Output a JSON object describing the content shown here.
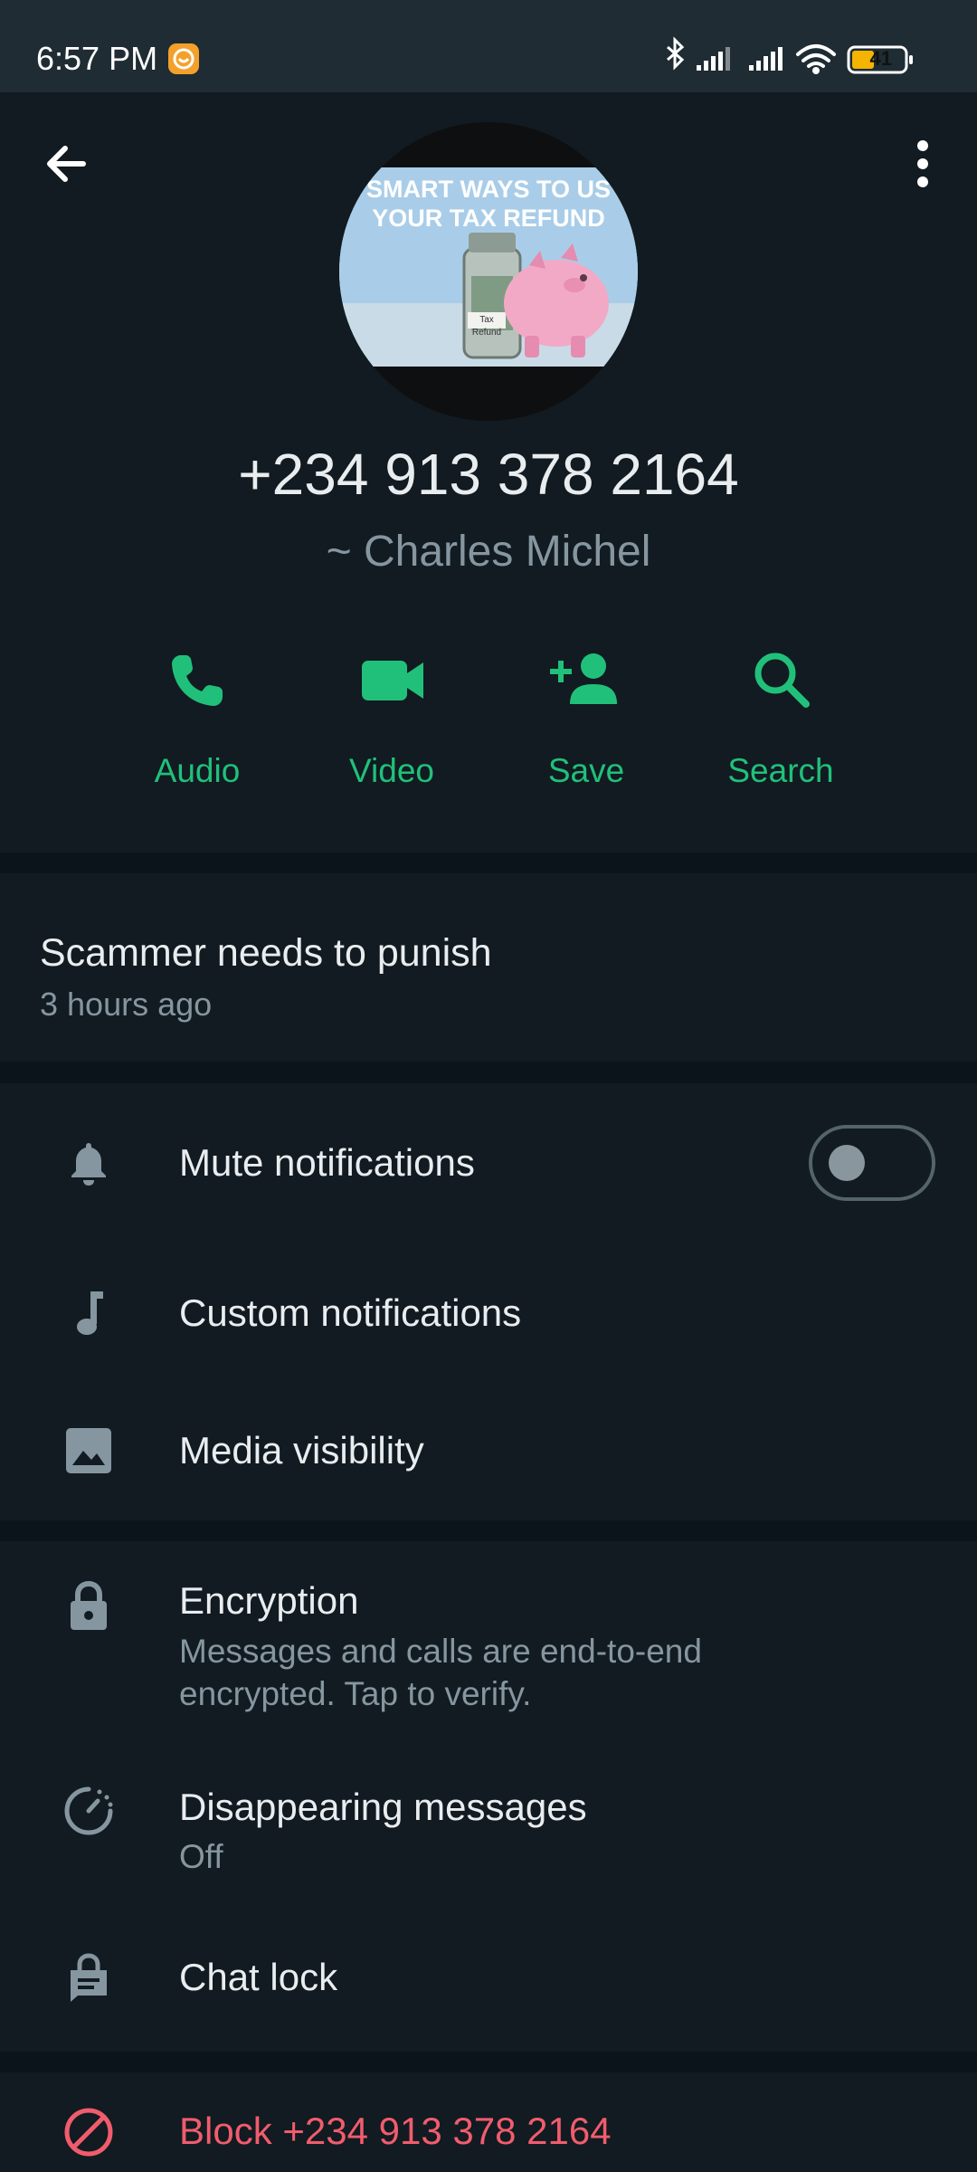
{
  "status_bar": {
    "time": "6:57 PM",
    "battery": "41",
    "icons": [
      "app-notification-icon",
      "bluetooth-icon",
      "signal-icon",
      "signal-icon",
      "wifi-icon",
      "battery-icon"
    ]
  },
  "header": {
    "back_icon": "back-arrow-icon",
    "menu_icon": "more-vert-icon",
    "avatar_caption_line1": "SMART WAYS TO US",
    "avatar_caption_line2": "YOUR TAX REFUND",
    "avatar_jar_label": "Tax Refund",
    "phone": "+234 913 378 2164",
    "name": "~ Charles Michel"
  },
  "actions": [
    {
      "label": "Audio",
      "icon": "phone-icon"
    },
    {
      "label": "Video",
      "icon": "video-icon"
    },
    {
      "label": "Save",
      "icon": "add-person-icon"
    },
    {
      "label": "Search",
      "icon": "search-icon"
    }
  ],
  "about": {
    "text": "Scammer needs to punish",
    "time": "3 hours ago"
  },
  "settings": {
    "mute": {
      "title": "Mute notifications",
      "enabled": false
    },
    "custom": {
      "title": "Custom notifications"
    },
    "media": {
      "title": "Media visibility"
    }
  },
  "privacy": {
    "encryption": {
      "title": "Encryption",
      "sub_line1": "Messages and calls are end-to-end",
      "sub_line2": "encrypted. Tap to verify."
    },
    "disappearing": {
      "title": "Disappearing messages",
      "value": "Off"
    },
    "chat_lock": {
      "title": "Chat lock"
    }
  },
  "block": {
    "label": "Block +234 913 378 2164"
  },
  "colors": {
    "accent": "#21c07a",
    "danger": "#f15c6d",
    "background": "#111b21",
    "divider": "#0b141a",
    "secondary_text": "#8696a0"
  }
}
